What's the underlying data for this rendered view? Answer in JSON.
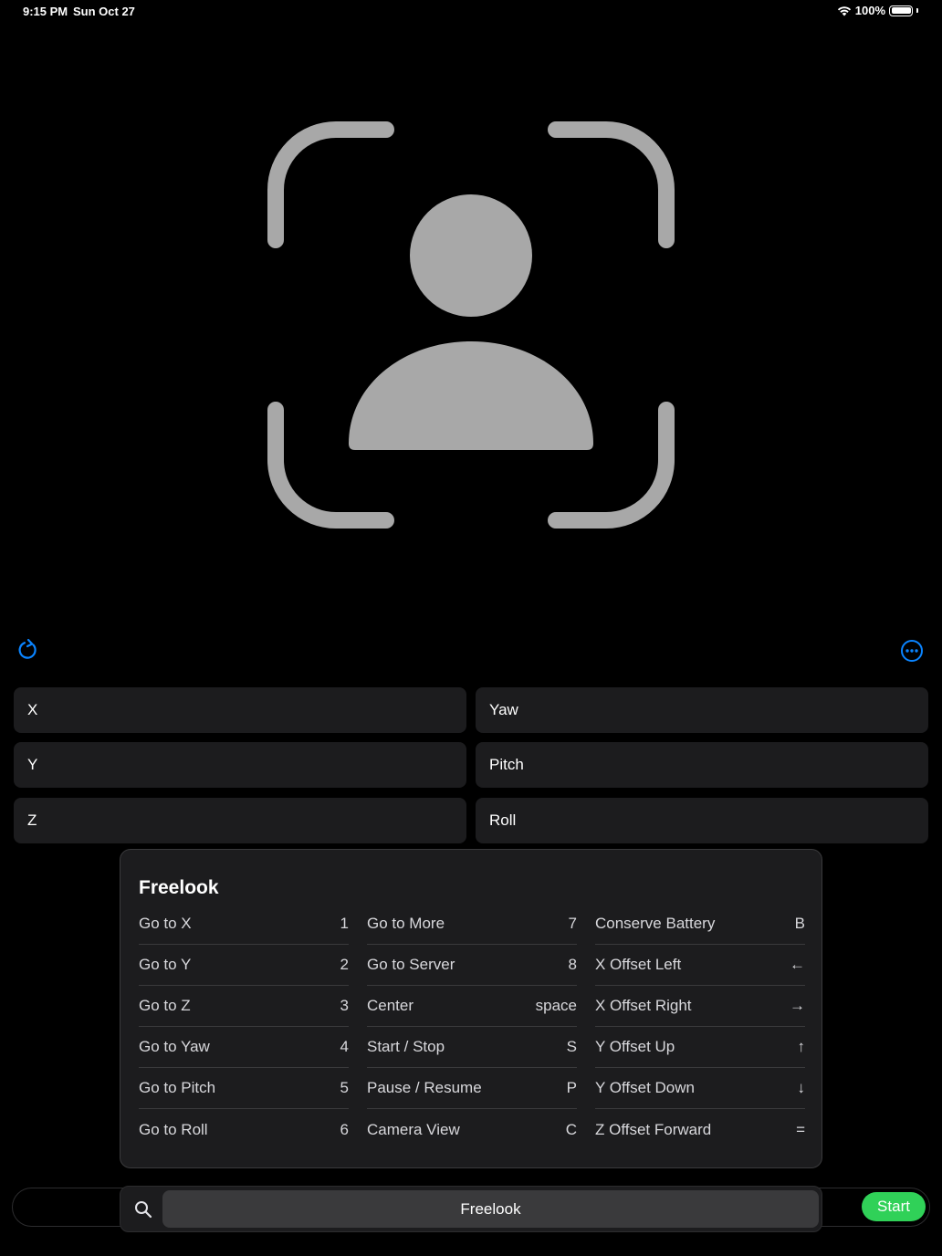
{
  "status_bar": {
    "time": "9:15 PM",
    "date": "Sun Oct 27",
    "battery": "100%",
    "icons": [
      "wifi-icon",
      "battery-icon"
    ]
  },
  "main": {
    "icon": "face-scan-person-icon",
    "icon_color": "#a8a8a8"
  },
  "toolbar": {
    "refresh_icon": "refresh-icon",
    "more_icon": "ellipsis-circle-icon",
    "accent": "#0a84ff"
  },
  "fields": {
    "x": "X",
    "y": "Y",
    "z": "Z",
    "yaw": "Yaw",
    "pitch": "Pitch",
    "roll": "Roll"
  },
  "shortcuts_panel": {
    "title": "Freelook",
    "columns": [
      [
        {
          "label": "Go to X",
          "key": "1"
        },
        {
          "label": "Go to Y",
          "key": "2"
        },
        {
          "label": "Go to Z",
          "key": "3"
        },
        {
          "label": "Go to Yaw",
          "key": "4"
        },
        {
          "label": "Go to Pitch",
          "key": "5"
        },
        {
          "label": "Go to Roll",
          "key": "6"
        }
      ],
      [
        {
          "label": "Go to More",
          "key": "7"
        },
        {
          "label": "Go to Server",
          "key": "8"
        },
        {
          "label": "Center",
          "key": "space"
        },
        {
          "label": "Start / Stop",
          "key": "S"
        },
        {
          "label": "Pause / Resume",
          "key": "P"
        },
        {
          "label": "Camera View",
          "key": "C"
        }
      ],
      [
        {
          "label": "Conserve Battery",
          "key": "B"
        },
        {
          "label": "X Offset Left",
          "key": "←"
        },
        {
          "label": "X Offset Right",
          "key": "→"
        },
        {
          "label": "Y Offset Up",
          "key": "↑"
        },
        {
          "label": "Y Offset Down",
          "key": "↓"
        },
        {
          "label": "Z Offset Forward",
          "key": "="
        }
      ]
    ]
  },
  "search": {
    "value": "Freelook",
    "icon": "search-icon"
  },
  "start_button": {
    "label": "Start",
    "color": "#30d158"
  }
}
